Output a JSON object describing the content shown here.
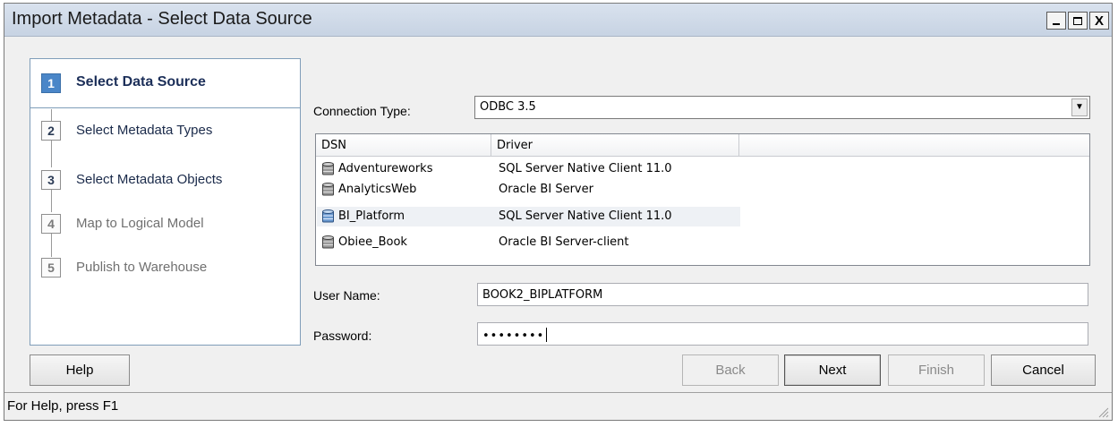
{
  "window": {
    "title": "Import Metadata - Select Data Source",
    "controls": {
      "minimize": "_",
      "maximize": "□",
      "close": "X"
    }
  },
  "steps": [
    {
      "number": "1",
      "label": "Select Data Source",
      "state": "current"
    },
    {
      "number": "2",
      "label": "Select Metadata Types",
      "state": "enabled"
    },
    {
      "number": "3",
      "label": "Select Metadata Objects",
      "state": "enabled"
    },
    {
      "number": "4",
      "label": "Map to Logical Model",
      "state": "disabled"
    },
    {
      "number": "5",
      "label": "Publish to Warehouse",
      "state": "disabled"
    }
  ],
  "form": {
    "connection_type_label": "Connection Type:",
    "connection_type_value": "ODBC 3.5",
    "dsn_list": {
      "columns": [
        "DSN",
        "Driver",
        ""
      ],
      "rows": [
        {
          "dsn": "Adventureworks",
          "driver": "SQL Server Native Client 11.0",
          "selected": false
        },
        {
          "dsn": "AnalyticsWeb",
          "driver": "Oracle BI Server",
          "selected": false
        },
        {
          "dsn": "BI_Platform",
          "driver": "SQL Server Native Client 11.0",
          "selected": true
        },
        {
          "dsn": "Obiee_Book",
          "driver": "Oracle BI Server-client",
          "selected": false
        }
      ]
    },
    "user_name_label": "User Name:",
    "user_name_value": "BOOK2_BIPLATFORM",
    "password_label": "Password:",
    "password_value": "••••••••"
  },
  "buttons": {
    "help": "Help",
    "back": "Back",
    "next": "Next",
    "finish": "Finish",
    "cancel": "Cancel"
  },
  "status_bar": {
    "text": "For Help, press F1"
  }
}
